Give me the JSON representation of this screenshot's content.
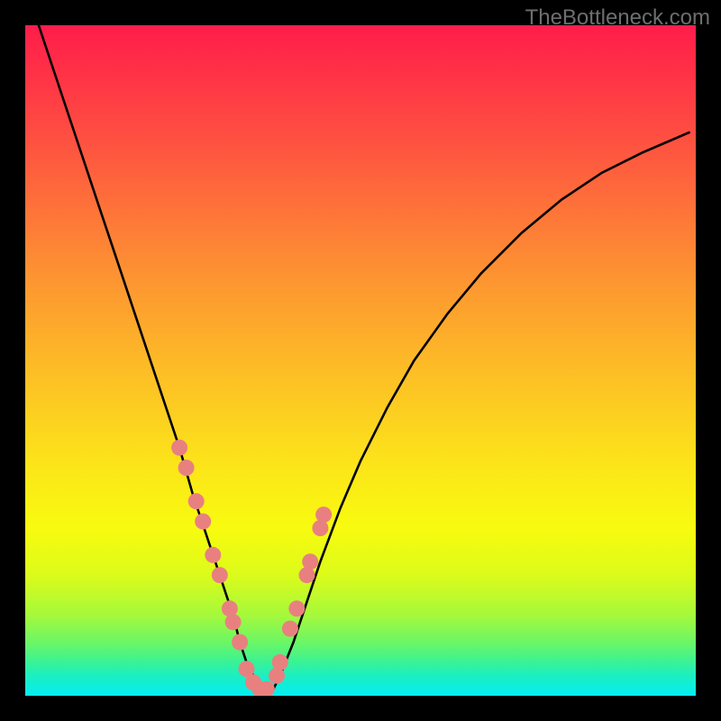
{
  "watermark": "TheBottleneck.com",
  "chart_data": {
    "type": "line",
    "title": "",
    "xlabel": "",
    "ylabel": "",
    "xlim": [
      0,
      100
    ],
    "ylim": [
      0,
      100
    ],
    "series": [
      {
        "name": "bottleneck-curve",
        "x": [
          2,
          5,
          8,
          11,
          14,
          17,
          20,
          23,
          25,
          27,
          29,
          31,
          32,
          33,
          34,
          35,
          36,
          37,
          38,
          40,
          42,
          44,
          47,
          50,
          54,
          58,
          63,
          68,
          74,
          80,
          86,
          92,
          99
        ],
        "y": [
          100,
          91,
          82,
          73,
          64,
          55,
          46,
          37,
          30,
          24,
          18,
          12,
          8,
          5,
          3,
          1,
          1,
          1,
          3,
          8,
          14,
          20,
          28,
          35,
          43,
          50,
          57,
          63,
          69,
          74,
          78,
          81,
          84
        ]
      }
    ],
    "markers": [
      {
        "name": "datapoints",
        "color": "#E98080",
        "x": [
          23,
          24,
          25.5,
          26.5,
          28,
          29,
          30.5,
          31,
          32,
          33,
          34,
          35,
          36,
          37.5,
          38,
          39.5,
          40.5,
          42,
          42.5,
          44,
          44.5
        ],
        "y": [
          37,
          34,
          29,
          26,
          21,
          18,
          13,
          11,
          8,
          4,
          2,
          1,
          1,
          3,
          5,
          10,
          13,
          18,
          20,
          25,
          27
        ]
      }
    ]
  }
}
